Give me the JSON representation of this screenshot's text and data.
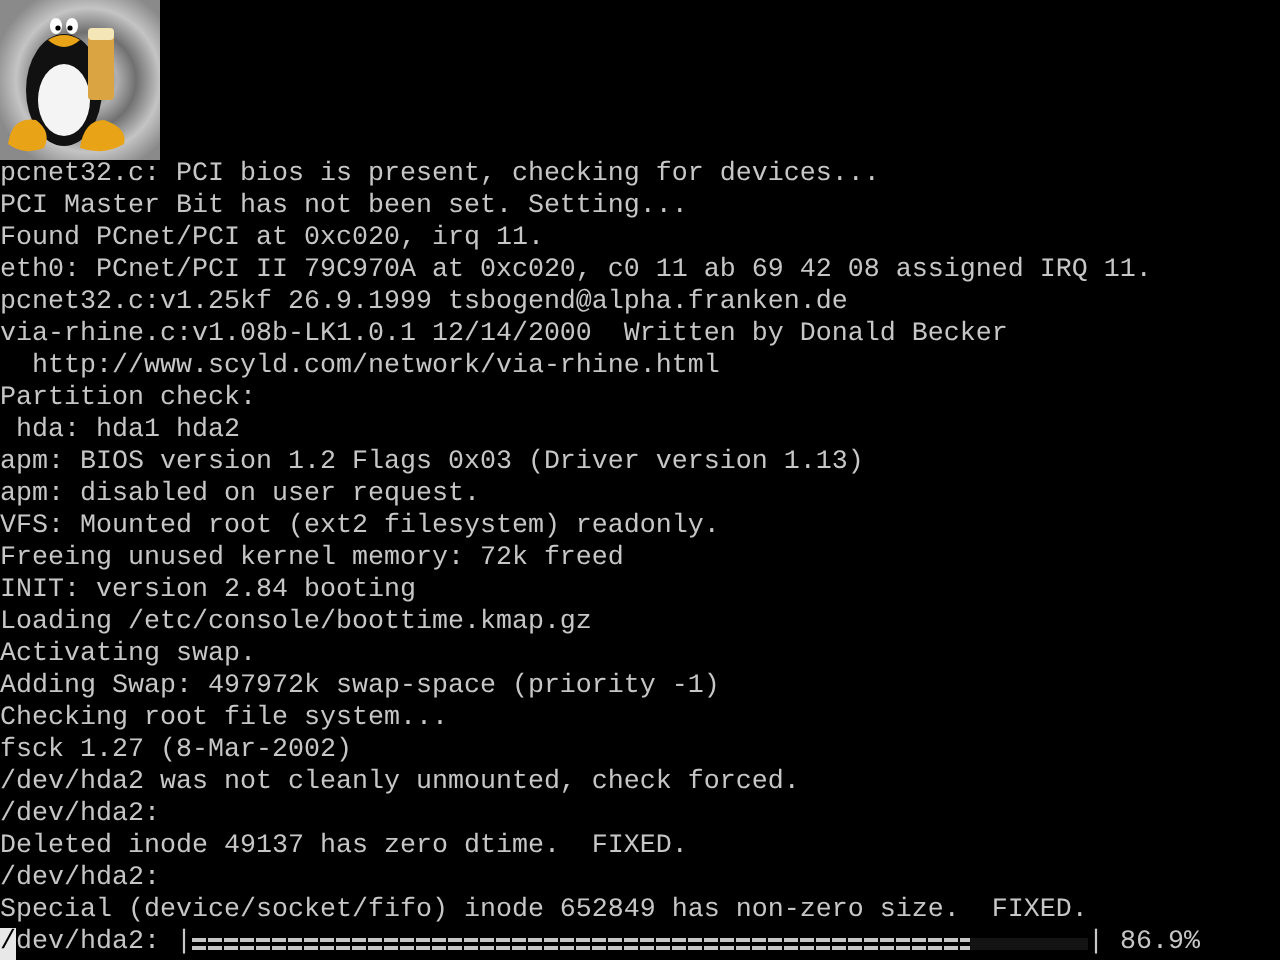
{
  "console": {
    "lines": [
      "pcnet32.c: PCI bios is present, checking for devices...",
      "PCI Master Bit has not been set. Setting...",
      "Found PCnet/PCI at 0xc020, irq 11.",
      "eth0: PCnet/PCI II 79C970A at 0xc020, c0 11 ab 69 42 08 assigned IRQ 11.",
      "pcnet32.c:v1.25kf 26.9.1999 tsbogend@alpha.franken.de",
      "via-rhine.c:v1.08b-LK1.0.1 12/14/2000  Written by Donald Becker",
      "  http://www.scyld.com/network/via-rhine.html",
      "Partition check:",
      " hda: hda1 hda2",
      "apm: BIOS version 1.2 Flags 0x03 (Driver version 1.13)",
      "apm: disabled on user request.",
      "VFS: Mounted root (ext2 filesystem) readonly.",
      "Freeing unused kernel memory: 72k freed",
      "INIT: version 2.84 booting",
      "Loading /etc/console/boottime.kmap.gz",
      "Activating swap.",
      "Adding Swap: 497972k swap-space (priority -1)",
      "Checking root file system...",
      "fsck 1.27 (8-Mar-2002)",
      "/dev/hda2 was not cleanly unmounted, check forced.",
      "/dev/hda2:",
      "Deleted inode 49137 has zero dtime.  FIXED.",
      "/dev/hda2:",
      "Special (device/socket/fifo) inode 652849 has non-zero size.  FIXED."
    ],
    "progress": {
      "cursor_char": "/",
      "label": "dev/hda2:",
      "left_bracket": "|",
      "level": 0.869,
      "right_bracket": "|",
      "reading": "86.9%"
    }
  }
}
